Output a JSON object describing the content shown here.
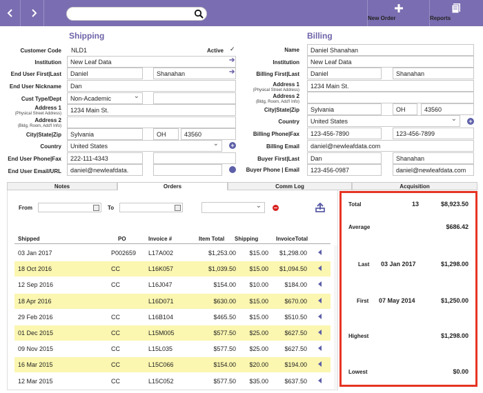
{
  "toolbar": {
    "back_icon": "chevron-left-icon",
    "forward_icon": "chevron-right-icon",
    "search_value": "",
    "new_order_label": "New Order",
    "reports_label": "Reports"
  },
  "shipping": {
    "title": "Shipping",
    "customer_code_label": "Customer Code",
    "customer_code": "NLD1",
    "active_label": "Active",
    "active_checked": "✓",
    "institution_label": "Institution",
    "institution": "New Leaf Data",
    "end_user_name_label": "End User First|Last",
    "first_name": "Daniel",
    "last_name": "Shanahan",
    "nickname_label": "End User Nickname",
    "nickname": "Dan",
    "cust_type_label": "Cust Type/Dept",
    "cust_type": "Non-Academic",
    "dept": "",
    "address1_label": "Address 1",
    "address1_sub": "(Physical Street Address)",
    "address1": "1234 Main St.",
    "address2_label": "Address 2",
    "address2_sub": "(Bldg, Room, Add'l Info)",
    "address2": "",
    "city_state_zip_label": "City|State|Zip",
    "city": "Sylvania",
    "state": "OH",
    "zip": "43560",
    "country_label": "Country",
    "country": "United States",
    "phone_fax_label": "End User Phone|Fax",
    "phone": "222-111-4343",
    "fax": "",
    "email_url_label": "End User Email/URL",
    "email": "daniel@newleafdata.",
    "url": ""
  },
  "billing": {
    "title": "Billing",
    "name_label": "Name",
    "name": "Daniel Shanahan",
    "institution_label": "Institution",
    "institution": "New Leaf Data",
    "first_last_label": "Billing First|Last",
    "first_name": "Daniel",
    "last_name": "Shanahan",
    "address1_label": "Address 1",
    "address1_sub": "(Physical Street Address)",
    "address1": "1234 Main St.",
    "address2_label": "Address 2",
    "address2_sub": "(Bldg, Room, Add'l Info)",
    "address2": "",
    "city_state_zip_label": "City|State|Zip",
    "city": "Sylvania",
    "state": "OH",
    "zip": "43560",
    "country_label": "Country",
    "country": "United States",
    "phone_fax_label": "Billing Phone|Fax",
    "phone": "123-456-7890",
    "fax": "123-456-7899",
    "email_label": "Billing Email",
    "email": "daniel@newleafdata.com",
    "buyer_label": "Buyer First|Last",
    "buyer_first": "Dan",
    "buyer_last": "Shanahan",
    "buyer_contact_label": "Buyer Phone | Email",
    "buyer_phone": "123-456-0987",
    "buyer_email": "daniel@newleafdata.com"
  },
  "tabs": [
    "Notes",
    "Orders",
    "Comm Log",
    "Acquisition"
  ],
  "filters": {
    "from_label": "From",
    "from_value": "",
    "to_label": "To",
    "to_value": "",
    "select_value": ""
  },
  "orders": {
    "columns": [
      "Shipped",
      "PO",
      "Invoice #",
      "Item Total",
      "Shipping",
      "InvoiceTotal"
    ],
    "rows": [
      {
        "shipped": "03 Jan 2017",
        "po": "P002659",
        "invoice": "L17A002",
        "item_total": "$1,253.00",
        "shipping": "$15.00",
        "invoice_total": "$1,298.00"
      },
      {
        "shipped": "18 Oct 2016",
        "po": "CC",
        "invoice": "L16K057",
        "item_total": "$1,039.50",
        "shipping": "$15.00",
        "invoice_total": "$1,094.50"
      },
      {
        "shipped": "12 Sep 2016",
        "po": "CC",
        "invoice": "L16J047",
        "item_total": "$154.00",
        "shipping": "$10.00",
        "invoice_total": "$184.00"
      },
      {
        "shipped": "18 Apr 2016",
        "po": "",
        "invoice": "L16D071",
        "item_total": "$630.00",
        "shipping": "$15.00",
        "invoice_total": "$670.00"
      },
      {
        "shipped": "29 Feb 2016",
        "po": "CC",
        "invoice": "L16B104",
        "item_total": "$465.50",
        "shipping": "$15.00",
        "invoice_total": "$510.50"
      },
      {
        "shipped": "01 Dec 2015",
        "po": "CC",
        "invoice": "L15M005",
        "item_total": "$577.50",
        "shipping": "$25.00",
        "invoice_total": "$627.50"
      },
      {
        "shipped": "09 Nov 2015",
        "po": "CC",
        "invoice": "L15L035",
        "item_total": "$577.50",
        "shipping": "$25.00",
        "invoice_total": "$627.50"
      },
      {
        "shipped": "16 Mar 2015",
        "po": "CC",
        "invoice": "L15C066",
        "item_total": "$154.00",
        "shipping": "$20.00",
        "invoice_total": "$194.00"
      },
      {
        "shipped": "12 Mar 2015",
        "po": "CC",
        "invoice": "L15C052",
        "item_total": "$577.50",
        "shipping": "$35.00",
        "invoice_total": "$637.50"
      }
    ]
  },
  "stats": {
    "total_label": "Total",
    "total_count": "13",
    "total_amount": "$8,923.50",
    "average_label": "Average",
    "average_amount": "$686.42",
    "last_label": "Last",
    "last_date": "03 Jan 2017",
    "last_amount": "$1,298.00",
    "first_label": "First",
    "first_date": "07 May 2014",
    "first_amount": "$1,250.00",
    "highest_label": "Highest",
    "highest_amount": "$1,298.00",
    "lowest_label": "Lowest",
    "lowest_amount": "$0.00"
  },
  "colors": {
    "toolbar": "#7b6db1",
    "highlight_row": "#fbf6b0",
    "stats_border": "#e63323",
    "section_title": "#6e63a8"
  }
}
